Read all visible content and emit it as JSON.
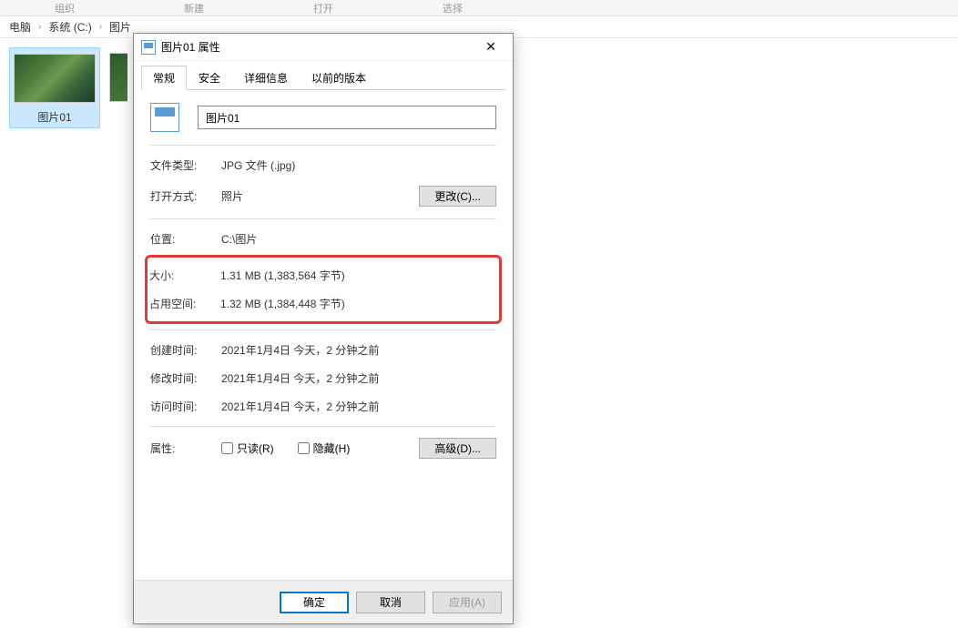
{
  "ribbon": {
    "items": [
      "组织",
      "新建",
      "打开",
      "选择"
    ]
  },
  "breadcrumb": {
    "parts": [
      "电脑",
      "系统 (C:)",
      "图片"
    ]
  },
  "thumbnails": {
    "item1": {
      "caption": "图片01"
    }
  },
  "dialog": {
    "title": "图片01 属性",
    "close": "✕",
    "tabs": {
      "general": "常规",
      "security": "安全",
      "details": "详细信息",
      "previous": "以前的版本"
    },
    "filename": "图片01",
    "rows": {
      "filetype_label": "文件类型:",
      "filetype_value": "JPG 文件 (.jpg)",
      "openwith_label": "打开方式:",
      "openwith_value": "照片",
      "change_btn": "更改(C)...",
      "location_label": "位置:",
      "location_value": "C:\\图片",
      "size_label": "大小:",
      "size_value": "1.31 MB (1,383,564 字节)",
      "sizedisk_label": "占用空间:",
      "sizedisk_value": "1.32 MB (1,384,448 字节)",
      "created_label": "创建时间:",
      "created_value": "2021年1月4日 今天，2 分钟之前",
      "modified_label": "修改时间:",
      "modified_value": "2021年1月4日 今天，2 分钟之前",
      "accessed_label": "访问时间:",
      "accessed_value": "2021年1月4日 今天，2 分钟之前",
      "attrs_label": "属性:",
      "readonly_label": "只读(R)",
      "hidden_label": "隐藏(H)",
      "advanced_btn": "高级(D)..."
    },
    "footer": {
      "ok": "确定",
      "cancel": "取消",
      "apply": "应用(A)"
    }
  }
}
